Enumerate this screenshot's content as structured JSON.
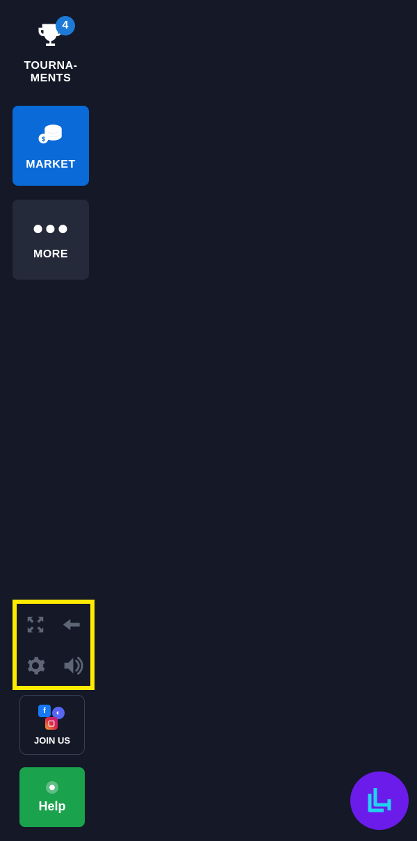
{
  "sidebar": {
    "tournaments": {
      "label": "TOURNA-\nMENTS",
      "badge": "4"
    },
    "market": {
      "label": "MARKET"
    },
    "more": {
      "label": "MORE"
    }
  },
  "controls": {
    "fullscreen": "fullscreen-icon",
    "back": "back-arrow-icon",
    "settings": "gear-icon",
    "sound": "volume-icon"
  },
  "joinus": {
    "label": "JOIN US"
  },
  "help": {
    "label": "Help"
  },
  "colors": {
    "accent": "#0a6ad7",
    "highlight": "#ffeb00",
    "help": "#1aa24d",
    "fab": "#6b1cea"
  }
}
